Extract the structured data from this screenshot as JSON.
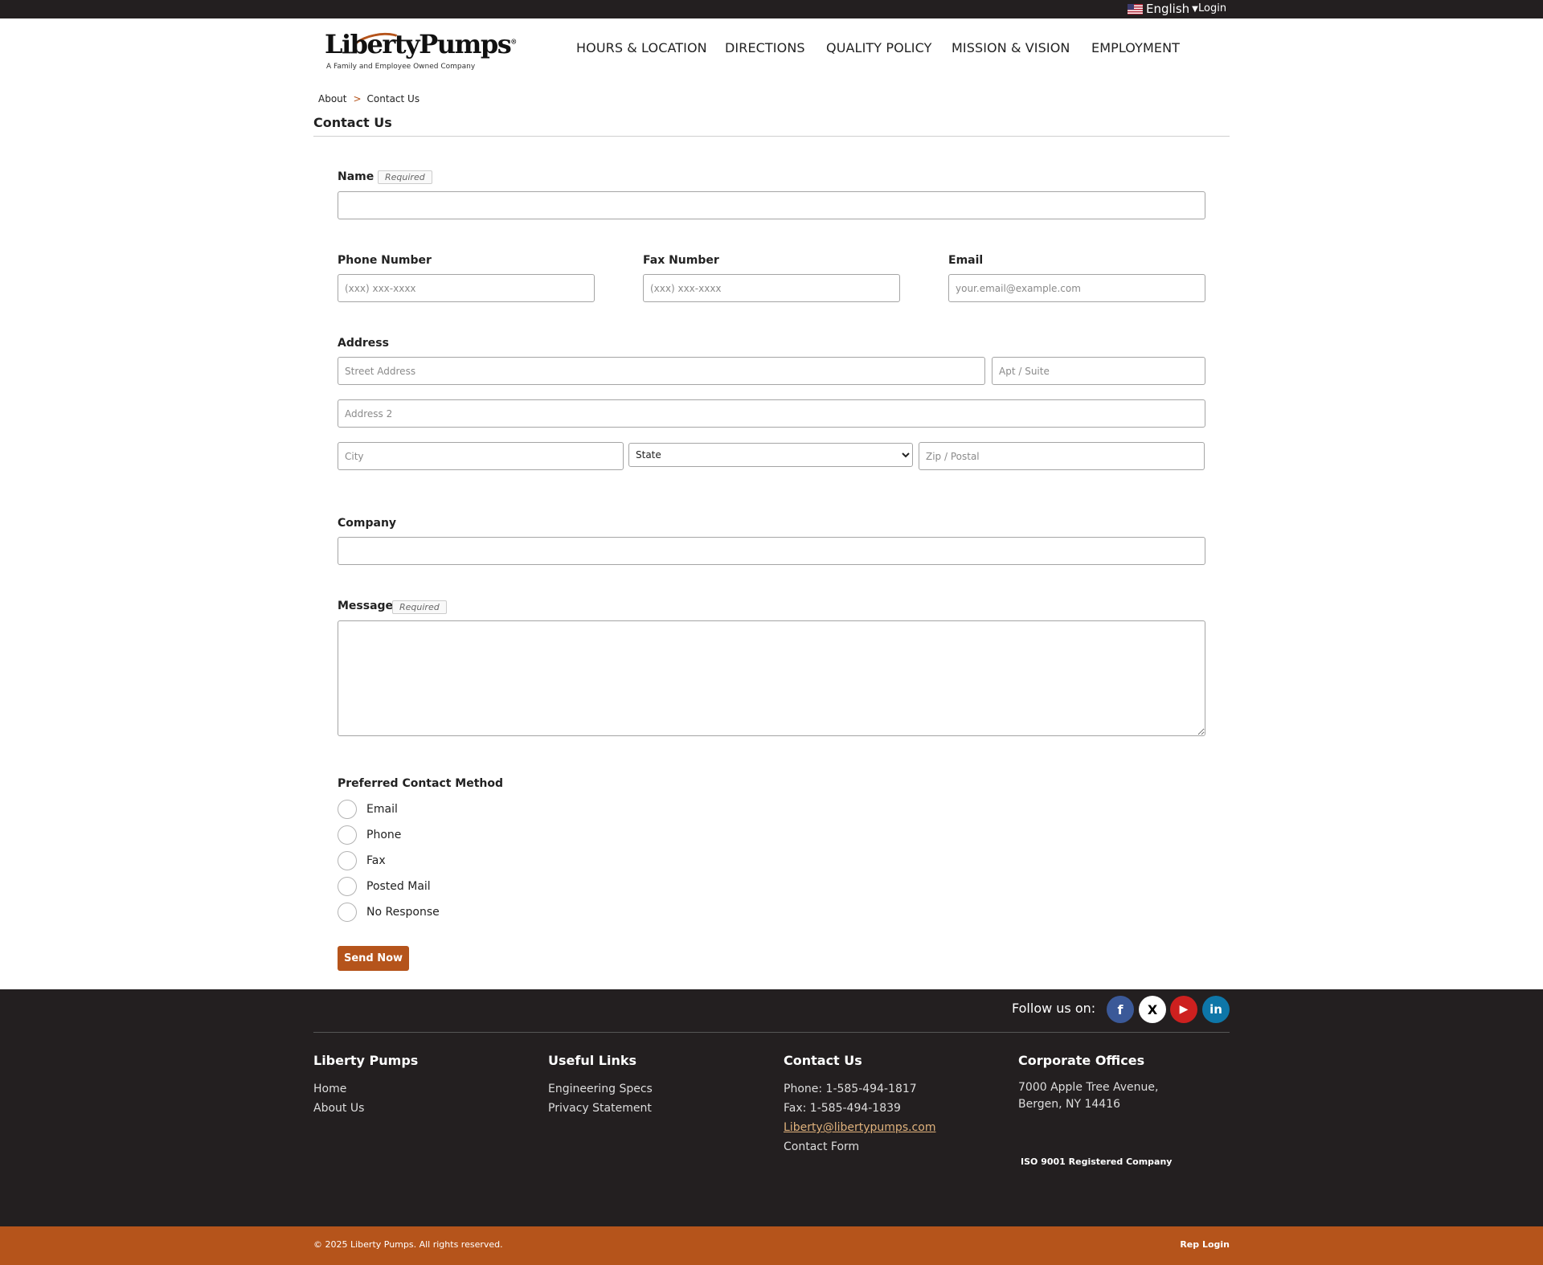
{
  "topbar": {
    "language": "English",
    "login": "Login"
  },
  "logo": {
    "name": "LibertyPumps",
    "tagline": "A Family and Employee Owned Company"
  },
  "nav": {
    "hours": "HOURS & LOCATION",
    "directions": "DIRECTIONS",
    "quality": "QUALITY POLICY",
    "mission": "MISSION & VISION",
    "employment": "EMPLOYMENT"
  },
  "breadcrumb": {
    "parent": "About",
    "separator": ">",
    "current": "Contact Us"
  },
  "page_title": "Contact Us",
  "form": {
    "required_badge": "Required",
    "name_label": "Name",
    "phone_label": "Phone Number",
    "phone_placeholder": "(xxx) xxx-xxxx",
    "fax_label": "Fax Number",
    "fax_placeholder": "(xxx) xxx-xxxx",
    "email_label": "Email",
    "email_placeholder": "your.email@example.com",
    "address_label": "Address",
    "street_placeholder": "Street Address",
    "apt_placeholder": "Apt / Suite",
    "address2_placeholder": "Address 2",
    "city_placeholder": "City",
    "state_selected": "State",
    "zip_placeholder": "Zip / Postal",
    "company_label": "Company",
    "message_label": "Message",
    "contact_method_label": "Preferred Contact Method",
    "contact_methods": [
      "Email",
      "Phone",
      "Fax",
      "Posted Mail",
      "No Response"
    ],
    "submit": "Send Now"
  },
  "footer": {
    "follow": "Follow us on:",
    "social": {
      "facebook": "f",
      "x": "X",
      "youtube": "▶",
      "linkedin": "in"
    },
    "col1": {
      "title": "Liberty Pumps",
      "links": [
        "Home",
        "About Us"
      ]
    },
    "col2": {
      "title": "Useful Links",
      "links": [
        "Engineering Specs",
        "Privacy Statement"
      ]
    },
    "col3": {
      "title": "Contact Us",
      "phone": "Phone: 1-585-494-1817",
      "fax": "Fax: 1-585-494-1839",
      "email": "Liberty@libertypumps.com",
      "form": "Contact Form"
    },
    "col4": {
      "title": "Corporate Offices",
      "address1": "7000 Apple Tree Avenue,",
      "address2": "Bergen, NY 14416",
      "iso": "ISO 9001 Registered Company"
    },
    "copyright": "© 2025 Liberty Pumps. All rights reserved.",
    "rep_login": "Rep Login"
  },
  "colors": {
    "brand_orange": "#b5541b",
    "dark": "#231f20"
  }
}
